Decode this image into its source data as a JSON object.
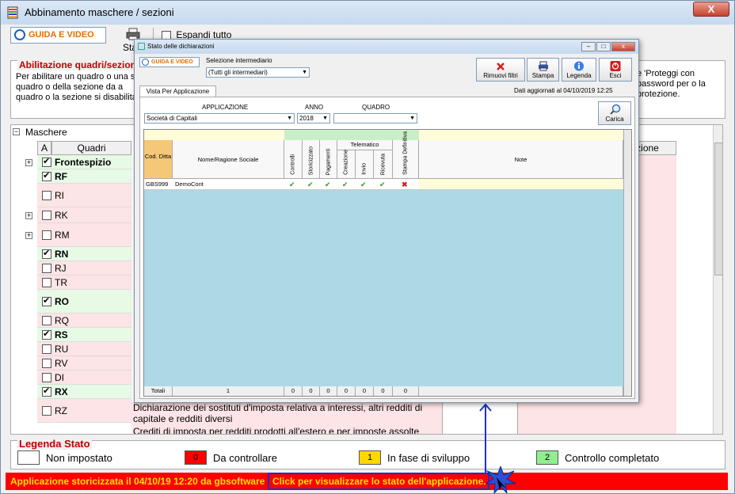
{
  "window": {
    "title": "Abbinamento maschere / sezioni",
    "close_label": "X"
  },
  "toolbar": {
    "guida_label": "GUIDA E VIDEO",
    "stampa_label": "Stam",
    "espandi_label": "Espandi tutto",
    "espandi_checked": false
  },
  "abilitazione": {
    "title": "Abilitazione quadri/sezioni",
    "text_left": "Per abilitare un quadro o una s del quadro o della sezione da a quadro o la sezione si disabilita",
    "text_right": "e 'Proteggi con password per o la protezione."
  },
  "tree": {
    "root_label": "Maschere",
    "col_a": "A",
    "col_quadri": "Quadri",
    "col_right": "zione",
    "rows": [
      {
        "name": "Frontespizio",
        "checked": true,
        "bold": true,
        "state": "green",
        "expandable": true
      },
      {
        "name": "RF",
        "checked": true,
        "bold": true,
        "state": "green",
        "expandable": false
      },
      {
        "name": "RI",
        "checked": false,
        "bold": false,
        "state": "pink",
        "expandable": false
      },
      {
        "name": "RK",
        "checked": false,
        "bold": false,
        "state": "pink",
        "expandable": true
      },
      {
        "name": "RM",
        "checked": false,
        "bold": false,
        "state": "pink",
        "expandable": true
      },
      {
        "name": "RN",
        "checked": true,
        "bold": true,
        "state": "green",
        "expandable": false
      },
      {
        "name": "RJ",
        "checked": false,
        "bold": false,
        "state": "pink",
        "expandable": false
      },
      {
        "name": "TR",
        "checked": false,
        "bold": false,
        "state": "pink",
        "expandable": false
      },
      {
        "name": "RO",
        "checked": true,
        "bold": true,
        "state": "green",
        "expandable": false
      },
      {
        "name": "RQ",
        "checked": false,
        "bold": false,
        "state": "pink",
        "expandable": false
      },
      {
        "name": "RS",
        "checked": true,
        "bold": true,
        "state": "green",
        "expandable": false
      },
      {
        "name": "RU",
        "checked": false,
        "bold": false,
        "state": "pink",
        "expandable": false
      },
      {
        "name": "RV",
        "checked": false,
        "bold": false,
        "state": "pink",
        "expandable": false
      },
      {
        "name": "DI",
        "checked": false,
        "bold": false,
        "state": "pink",
        "expandable": false
      },
      {
        "name": "RX",
        "checked": true,
        "bold": true,
        "state": "green",
        "expandable": false
      },
      {
        "name": "RZ",
        "checked": false,
        "bold": false,
        "state": "pink",
        "expandable": false
      }
    ],
    "desc_rz": "Dichiarazione dei sostituti d'imposta relativa a interessi, altri redditi di capitale e redditi diversi",
    "desc_next": "Crediti di imposta per redditi prodotti all'estero e per imposte assolte"
  },
  "legenda": {
    "title": "Legenda Stato",
    "items": [
      {
        "box": "",
        "label": "Non impostato",
        "color": "#ffffff"
      },
      {
        "box": "0",
        "label": "Da controllare",
        "color": "#ff0000"
      },
      {
        "box": "1",
        "label": "In fase di sviluppo",
        "color": "#ffd700"
      },
      {
        "box": "2",
        "label": "Controllo completato",
        "color": "#90ee90"
      }
    ]
  },
  "status": {
    "text": "Applicazione storicizzata il 04/10/19 12:20 da gbsoftware",
    "click_text": "Click per visualizzare lo stato dell'applicazione."
  },
  "modal": {
    "title": "Stato delle dichiarazioni",
    "guida_label": "GUIDA E VIDEO",
    "selezione_label": "Selezione intermediario",
    "selezione_value": "(Tutti gli intermediari)",
    "buttons": {
      "rimuovi": "Rimuovi filtri",
      "stampa": "Stampa",
      "legenda": "Legenda",
      "esci": "Esci"
    },
    "dati": "Dati aggiornati al 04/10/2019 12:25",
    "tab": "Vista Per Applicazione",
    "filters": {
      "applicazione_label": "APPLICAZIONE",
      "applicazione_value": "Società di Capitali",
      "anno_label": "ANNO",
      "anno_value": "2018",
      "quadro_label": "QUADRO",
      "quadro_value": "",
      "carica_label": "Carica"
    },
    "grid": {
      "col_cod": "Cod. Ditta",
      "col_nome": "Nome/Ragione Sociale",
      "col_controlli": "Controlli",
      "col_storicizzato": "Storicizzato",
      "col_pagamenti": "Pagamenti",
      "col_telematico": "Telematico",
      "col_creazione": "Creazione",
      "col_invio": "Invio",
      "col_ricevuta": "Ricevuta",
      "col_stampa": "Stampa Definitiva",
      "col_note": "Note",
      "rows": [
        {
          "cod": "GBS999",
          "nome": "DemoCont",
          "controlli": true,
          "storicizzato": true,
          "pagamenti": true,
          "creazione": true,
          "invio": true,
          "ricevuta": true,
          "stampa": false,
          "note": ""
        }
      ],
      "footer": {
        "label": "Totali",
        "count": "1",
        "c1": "0",
        "c2": "0",
        "c3": "0",
        "c4": "0",
        "c5": "0",
        "c6": "0",
        "c7": "0"
      }
    }
  }
}
